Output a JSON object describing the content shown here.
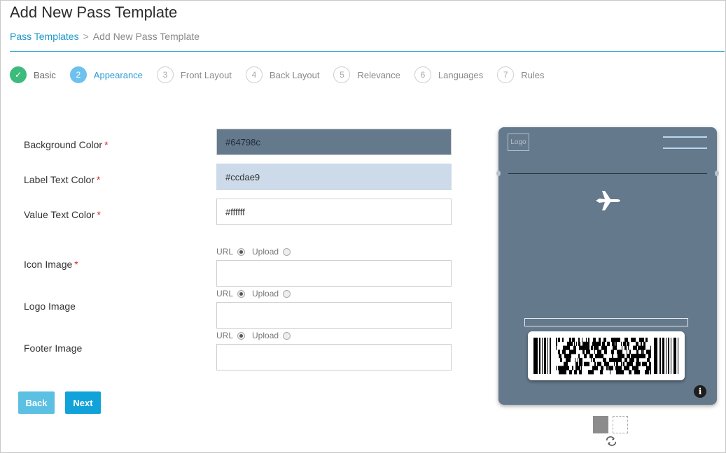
{
  "page": {
    "title": "Add New Pass Template"
  },
  "breadcrumb": {
    "link": "Pass Templates",
    "separator": ">",
    "current": "Add New Pass Template"
  },
  "steps": [
    {
      "num": "✓",
      "label": "Basic",
      "state": "done"
    },
    {
      "num": "2",
      "label": "Appearance",
      "state": "active"
    },
    {
      "num": "3",
      "label": "Front Layout",
      "state": "pending"
    },
    {
      "num": "4",
      "label": "Back Layout",
      "state": "pending"
    },
    {
      "num": "5",
      "label": "Relevance",
      "state": "pending"
    },
    {
      "num": "6",
      "label": "Languages",
      "state": "pending"
    },
    {
      "num": "7",
      "label": "Rules",
      "state": "pending"
    }
  ],
  "form": {
    "required_mark": "*",
    "background_color": {
      "label": "Background Color",
      "value": "#64798c"
    },
    "label_text_color": {
      "label": "Label Text Color",
      "value": "#ccdae9"
    },
    "value_text_color": {
      "label": "Value Text Color",
      "value": "#ffffff"
    },
    "icon_image": {
      "label": "Icon Image",
      "source_url": "URL",
      "source_upload": "Upload",
      "selected": "URL",
      "value": ""
    },
    "logo_image": {
      "label": "Logo Image",
      "source_url": "URL",
      "source_upload": "Upload",
      "selected": "URL",
      "value": ""
    },
    "footer_image": {
      "label": "Footer Image",
      "source_url": "URL",
      "source_upload": "Upload",
      "selected": "URL",
      "value": ""
    }
  },
  "buttons": {
    "back": "Back",
    "next": "Next"
  },
  "preview": {
    "logo_placeholder": "Logo",
    "info_label": "i",
    "icons": {
      "plane": "airplane-icon",
      "info": "info-icon",
      "flip": "flip-icon"
    }
  },
  "colors": {
    "accent": "#10a2d9",
    "done": "#3dbb7c",
    "active": "#6ec1ee",
    "pass_bg": "#64798c",
    "label_bg": "#ccdae9"
  }
}
